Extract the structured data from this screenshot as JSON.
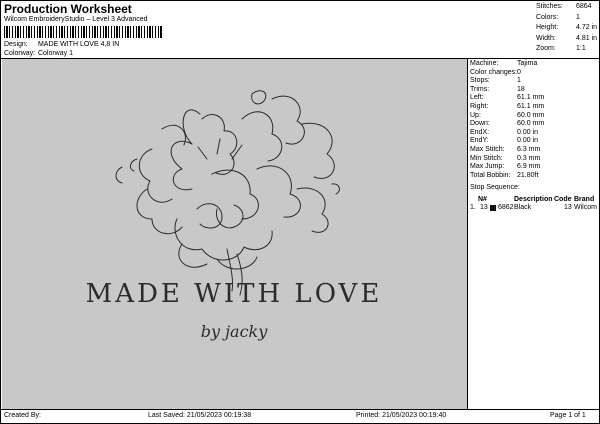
{
  "header": {
    "title": "Production Worksheet",
    "subtitle": "Wilcom EmbroideryStudio – Level 3 Advanced",
    "design_label": "Design:",
    "design_value": "MADE WITH LOVE 4,8 IN",
    "colorway_label": "Colorway:",
    "colorway_value": "Colorway 1"
  },
  "stats": [
    {
      "label": "Stitches:",
      "value": "6864"
    },
    {
      "label": "Colors:",
      "value": "1"
    },
    {
      "label": "Height:",
      "value": "4.72 in"
    },
    {
      "label": "Width:",
      "value": "4.81 in"
    },
    {
      "label": "Zoom:",
      "value": "1:1"
    }
  ],
  "details": [
    {
      "label": "Machine:",
      "value": "Tajima"
    },
    {
      "label": "Color changes:",
      "value": "0"
    },
    {
      "label": "Stops:",
      "value": "1"
    },
    {
      "label": "Trims:",
      "value": "18"
    },
    {
      "label": "Left:",
      "value": "61.1 mm"
    },
    {
      "label": "Right:",
      "value": "61.1 mm"
    },
    {
      "label": "Up:",
      "value": "60.0 mm"
    },
    {
      "label": "Down:",
      "value": "60.0 mm"
    },
    {
      "label": "EndX:",
      "value": "0.00 in"
    },
    {
      "label": "EndY:",
      "value": "0.00 in"
    },
    {
      "label": "Max Stitch:",
      "value": "6.3 mm"
    },
    {
      "label": "Min Stitch:",
      "value": "0.3 mm"
    },
    {
      "label": "Max Jump:",
      "value": "6.9 mm"
    },
    {
      "label": "Total Bobbin:",
      "value": "21.80ft"
    }
  ],
  "stop_sequence": {
    "title": "Stop Sequence:",
    "columns": [
      "N#",
      "Description",
      "Code",
      "Brand"
    ],
    "rows": [
      {
        "index": "1.",
        "n": "13",
        "stitches": "6862",
        "description": "Black",
        "code": "13",
        "brand": "Wilcom",
        "color": "#111111"
      }
    ]
  },
  "artwork": {
    "line1": "MADE WITH LOVE",
    "line2": "by jacky",
    "stroke": "#2b2b2b",
    "background": "#c8c8c8"
  },
  "footer": {
    "created_by": "Created By:",
    "last_saved": "Last Saved: 21/05/2023 00:19:38",
    "printed": "Printed: 21/05/2023 00:19:40",
    "page": "Page 1 of 1"
  }
}
